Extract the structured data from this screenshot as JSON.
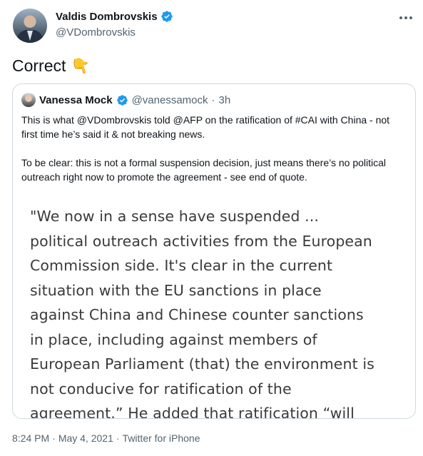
{
  "author": {
    "display_name": "Valdis Dombrovskis",
    "handle": "@VDombrovskis"
  },
  "tweet": {
    "text": "Correct",
    "emoji": "👇"
  },
  "quoted": {
    "display_name": "Vanessa Mock",
    "handle": "@vanessamock",
    "separator": "·",
    "time": "3h",
    "paragraph1": "This is what @VDombrovskis told @AFP on the ratification of #CAI with China - not first time he’s said it & not breaking news.",
    "paragraph2": "To be clear: this is not a formal suspension decision, just means there’s no political outreach right now to promote the agreement - see end of quote.",
    "image_lines": [
      "\"We now in a sense have suspended ...",
      "political outreach activities from the European",
      "Commission side. It's clear in the current",
      "situation with the EU sanctions in place",
      "against China and Chinese counter sanctions",
      "in place, including against members of",
      "European Parliament (that) the environment is",
      "not conducive for ratification of the",
      "agreement.” He added that ratification “will"
    ]
  },
  "meta": {
    "time": "8:24 PM",
    "separator1": "·",
    "date": "May 4, 2021",
    "separator2": "·",
    "source": "Twitter for iPhone"
  },
  "colors": {
    "verified": "#1d9bf0",
    "secondary_text": "#536471",
    "border": "#cfd9de"
  },
  "icons": {
    "verified": "verified-badge-icon",
    "more": "more-options-icon",
    "emoji": "pointing-down-hand-icon"
  }
}
